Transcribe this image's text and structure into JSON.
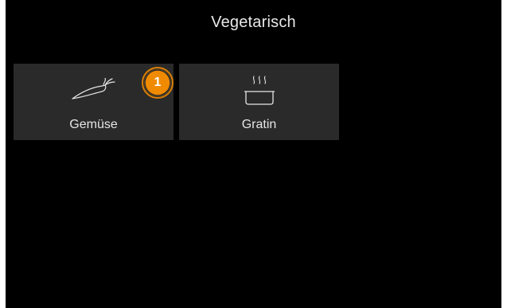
{
  "header": {
    "title": "Vegetarisch"
  },
  "tiles": [
    {
      "label": "Gemüse",
      "icon": "vegetable-icon"
    },
    {
      "label": "Gratin",
      "icon": "steaming-dish-icon"
    }
  ],
  "badge": {
    "number": "1",
    "color": "#f08a00"
  },
  "colors": {
    "background": "#000000",
    "tile": "#2a2a2a",
    "text": "#e6e6e6",
    "accent": "#f08a00"
  }
}
